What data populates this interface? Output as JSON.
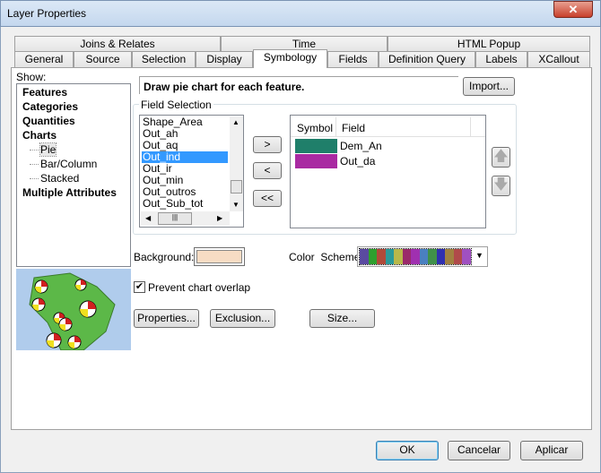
{
  "window": {
    "title": "Layer Properties",
    "close_label": "✕"
  },
  "tabs_row1": [
    "Joins & Relates",
    "Time",
    "HTML Popup"
  ],
  "tabs_row2": [
    "General",
    "Source",
    "Selection",
    "Display",
    "Symbology",
    "Fields",
    "Definition Query",
    "Labels",
    "XCallout"
  ],
  "selected_tab": "Symbology",
  "show": {
    "label": "Show:",
    "items": [
      {
        "label": "Features",
        "bold": true
      },
      {
        "label": "Categories",
        "bold": true
      },
      {
        "label": "Quantities",
        "bold": true
      },
      {
        "label": "Charts",
        "bold": true
      },
      {
        "label": "Pie",
        "selected": true
      },
      {
        "label": "Bar/Column"
      },
      {
        "label": "Stacked"
      },
      {
        "label": "Multiple Attributes",
        "bold": true
      }
    ]
  },
  "description": "Draw pie chart for each feature.",
  "import_label": "Import...",
  "field_selection": {
    "label": "Field Selection",
    "available": [
      "Shape_Area",
      "Out_ah",
      "Out_aq",
      "Out_ind",
      "Out_ir",
      "Out_min",
      "Out_outros",
      "Out_Sub_tot"
    ],
    "selected_available": "Out_ind",
    "add_label": ">",
    "remove_label": "<",
    "remove_all_label": "<<",
    "columns": [
      "Symbol",
      "Field"
    ],
    "fields": [
      {
        "color": "#1f7f6a",
        "name": "Dem_An"
      },
      {
        "color": "#a92aa2",
        "name": "Out_da"
      }
    ]
  },
  "background": {
    "label": "Background:",
    "color": "#f7dcc4"
  },
  "color_scheme": {
    "label": "Color  Scheme:",
    "colors": [
      "#5a4aa0",
      "#2ea02e",
      "#b04a3a",
      "#2a9a9a",
      "#b8b84a",
      "#9a2a6a",
      "#a030b0",
      "#4a80c0",
      "#40904a",
      "#3030b0",
      "#a08040",
      "#b04a4a",
      "#a050c0"
    ]
  },
  "prevent_overlap": {
    "label": "Prevent chart overlap",
    "checked": true
  },
  "buttons": {
    "properties": "Properties...",
    "exclusion": "Exclusion...",
    "size": "Size...",
    "ok": "OK",
    "cancel": "Cancelar",
    "apply": "Aplicar"
  }
}
